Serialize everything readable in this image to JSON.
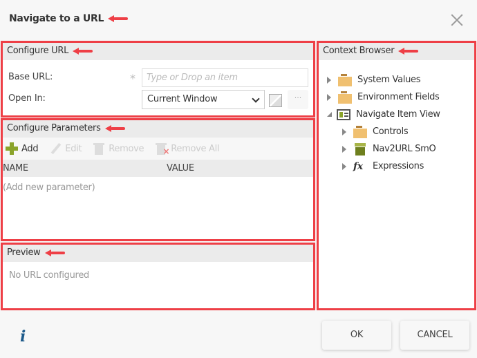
{
  "dialog": {
    "title": "Navigate to a URL",
    "close_icon": "close-icon"
  },
  "configure_url": {
    "heading": "Configure URL",
    "base_url_label": "Base URL:",
    "base_url_required": "*",
    "base_url_placeholder": "Type or Drop an item",
    "open_in_label": "Open In:",
    "open_in_value": "Current Window",
    "more_button": "···"
  },
  "configure_parameters": {
    "heading": "Configure Parameters",
    "toolbar": {
      "add": "Add",
      "edit": "Edit",
      "remove": "Remove",
      "remove_all": "Remove All"
    },
    "columns": [
      "NAME",
      "VALUE"
    ],
    "add_new_row": "(Add new parameter)"
  },
  "preview": {
    "heading": "Preview",
    "text": "No URL configured"
  },
  "context_browser": {
    "heading": "Context Browser",
    "items": [
      {
        "label": "System Values",
        "icon": "folder-icon",
        "expanded": false,
        "level": 0
      },
      {
        "label": "Environment Fields",
        "icon": "folder-icon",
        "expanded": false,
        "level": 0
      },
      {
        "label": "Navigate Item View",
        "icon": "view-icon",
        "expanded": true,
        "level": 0
      },
      {
        "label": "Controls",
        "icon": "folder-icon",
        "expanded": false,
        "level": 1
      },
      {
        "label": "Nav2URL SmO",
        "icon": "smartobject-icon",
        "expanded": false,
        "level": 1
      },
      {
        "label": "Expressions",
        "icon": "fx-icon",
        "expanded": false,
        "level": 1
      }
    ]
  },
  "footer": {
    "info_icon": "i",
    "ok": "OK",
    "cancel": "CANCEL"
  },
  "colors": {
    "annotation_red": "#ee3f46",
    "add_green": "#8aa32a",
    "info_blue": "#1d5a8a"
  }
}
